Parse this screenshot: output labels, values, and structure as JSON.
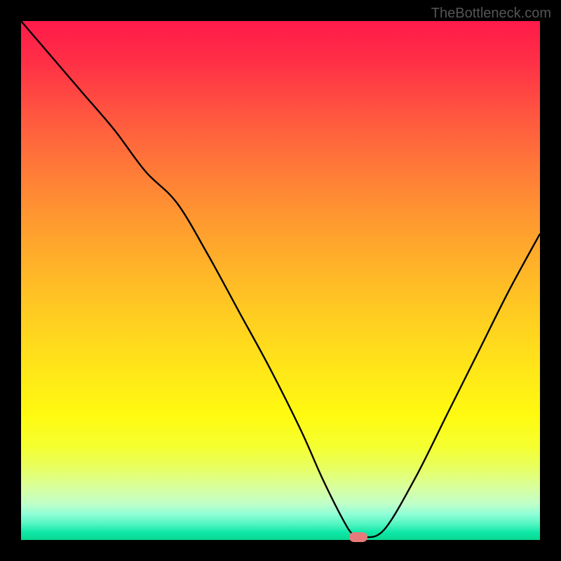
{
  "watermark": "TheBottleneck.com",
  "chart_data": {
    "type": "line",
    "title": "",
    "xlabel": "",
    "ylabel": "",
    "xlim": [
      0,
      100
    ],
    "ylim": [
      0,
      100
    ],
    "legend": false,
    "gradient_stops": [
      {
        "pos": 0,
        "color": "#ff1a4a"
      },
      {
        "pos": 50,
        "color": "#ffc820"
      },
      {
        "pos": 85,
        "color": "#fff820"
      },
      {
        "pos": 100,
        "color": "#08d890"
      }
    ],
    "series": [
      {
        "name": "bottleneck-curve",
        "color": "#000000",
        "x": [
          0,
          6,
          12,
          18,
          24,
          30,
          36,
          42,
          48,
          54,
          58,
          62,
          64,
          66,
          70,
          76,
          82,
          88,
          94,
          100
        ],
        "y": [
          100,
          93,
          86,
          79,
          71,
          65,
          55,
          44,
          33,
          21,
          12,
          4,
          1,
          0.5,
          2,
          12,
          24,
          36,
          48,
          59
        ]
      }
    ],
    "marker": {
      "x": 65,
      "y": 0.5,
      "color": "#e77a7a"
    }
  }
}
